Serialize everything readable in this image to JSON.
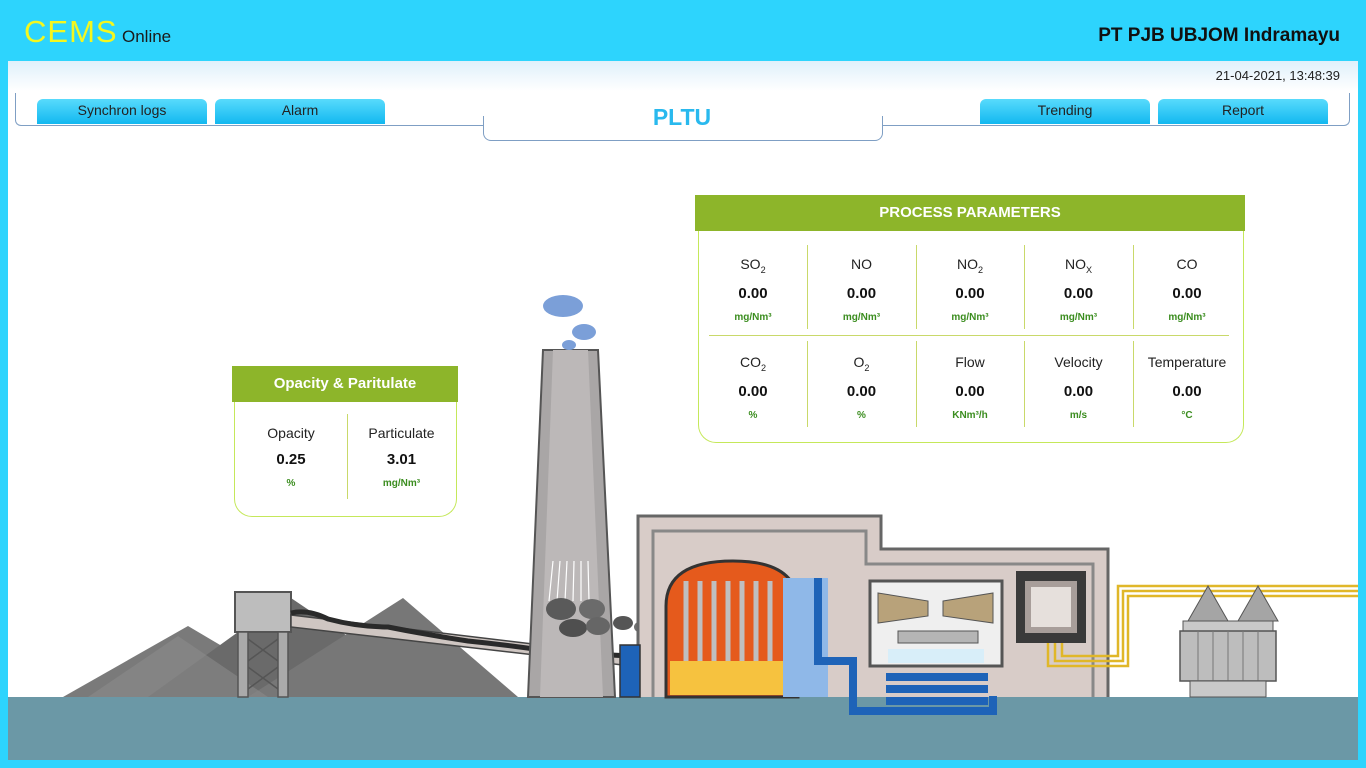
{
  "header": {
    "logo": "CEMS",
    "logo_sub": "Online",
    "company": "PT PJB UBJOM Indramayu"
  },
  "datetime": "21-04-2021, 13:48:39",
  "nav": {
    "synchron": "Synchron logs",
    "alarm": "Alarm",
    "title": "PLTU",
    "trending": "Trending",
    "report": "Report"
  },
  "opacity_panel": {
    "title": "Opacity & Paritulate",
    "items": [
      {
        "label": "Opacity",
        "value": "0.25",
        "unit": "%"
      },
      {
        "label": "Particulate",
        "value": "3.01",
        "unit": "mg/Nm³"
      }
    ]
  },
  "process_panel": {
    "title": "PROCESS PARAMETERS",
    "row1": [
      {
        "label": "SO",
        "sub": "2",
        "value": "0.00",
        "unit": "mg/Nm³"
      },
      {
        "label": "NO",
        "sub": "",
        "value": "0.00",
        "unit": "mg/Nm³"
      },
      {
        "label": "NO",
        "sub": "2",
        "value": "0.00",
        "unit": "mg/Nm³"
      },
      {
        "label": "NO",
        "sub": "X",
        "value": "0.00",
        "unit": "mg/Nm³"
      },
      {
        "label": "CO",
        "sub": "",
        "value": "0.00",
        "unit": "mg/Nm³"
      }
    ],
    "row2": [
      {
        "label": "CO",
        "sub": "2",
        "value": "0.00",
        "unit": "%"
      },
      {
        "label": "O",
        "sub": "2",
        "value": "0.00",
        "unit": "%"
      },
      {
        "label": "Flow",
        "sub": "",
        "value": "0.00",
        "unit": "KNm³/h"
      },
      {
        "label": "Velocity",
        "sub": "",
        "value": "0.00",
        "unit": "m/s"
      },
      {
        "label": "Temperature",
        "sub": "",
        "value": "0.00",
        "unit": "°C"
      }
    ]
  },
  "colors": {
    "accent": "#2dd4fd",
    "panel_green": "#8db52a",
    "unit_green": "#3b8d1f",
    "logo_yellow": "#f4f71e"
  }
}
